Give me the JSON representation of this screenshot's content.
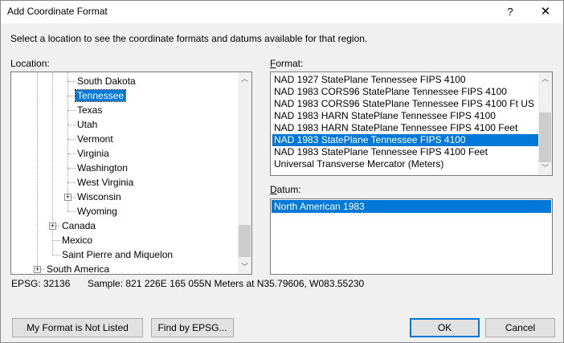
{
  "window": {
    "title": "Add Coordinate Format",
    "help_glyph": "?",
    "close_glyph": "✕"
  },
  "instructions": "Select a location to see the coordinate formats and datums available for that region.",
  "location": {
    "label": "Location:",
    "items": [
      {
        "label": "South Dakota"
      },
      {
        "label": "Tennessee",
        "selected": true
      },
      {
        "label": "Texas"
      },
      {
        "label": "Utah"
      },
      {
        "label": "Vermont"
      },
      {
        "label": "Virginia"
      },
      {
        "label": "Washington"
      },
      {
        "label": "West Virginia"
      },
      {
        "label": "Wisconsin",
        "expandable": true
      },
      {
        "label": "Wyoming"
      },
      {
        "label": "Canada",
        "expandable": true
      },
      {
        "label": "Mexico"
      },
      {
        "label": "Saint Pierre and Miquelon"
      },
      {
        "label": "South America",
        "expandable": true
      }
    ]
  },
  "format": {
    "label_prefix": "",
    "label_underlined": "F",
    "label_rest": "ormat:",
    "items": [
      {
        "label": "NAD 1927 StatePlane Tennessee FIPS 4100"
      },
      {
        "label": "NAD 1983 CORS96 StatePlane Tennessee FIPS 4100"
      },
      {
        "label": "NAD 1983 CORS96 StatePlane Tennessee FIPS 4100 Ft US"
      },
      {
        "label": "NAD 1983 HARN StatePlane Tennessee FIPS 4100"
      },
      {
        "label": "NAD 1983 HARN StatePlane Tennessee FIPS 4100 Feet"
      },
      {
        "label": "NAD 1983 StatePlane Tennessee FIPS 4100",
        "selected": true
      },
      {
        "label": "NAD 1983 StatePlane Tennessee FIPS 4100 Feet"
      },
      {
        "label": "Universal Transverse Mercator (Meters)"
      }
    ]
  },
  "datum": {
    "label_underlined": "D",
    "label_rest": "atum:",
    "items": [
      {
        "label": "North American 1983",
        "selected": true
      }
    ]
  },
  "info": {
    "epsg": "EPSG: 32136",
    "sample": "Sample: 821 226E  165 055N Meters at N35.79606, W083.55230"
  },
  "buttons": {
    "not_listed": "My Format is Not Listed",
    "find_epsg": "Find by EPSG...",
    "ok": "OK",
    "cancel": "Cancel"
  },
  "scroll_icons": {
    "up": "chevron-up-icon",
    "down": "chevron-down-icon",
    "up_glyph": "︿",
    "down_glyph": "﹀"
  }
}
